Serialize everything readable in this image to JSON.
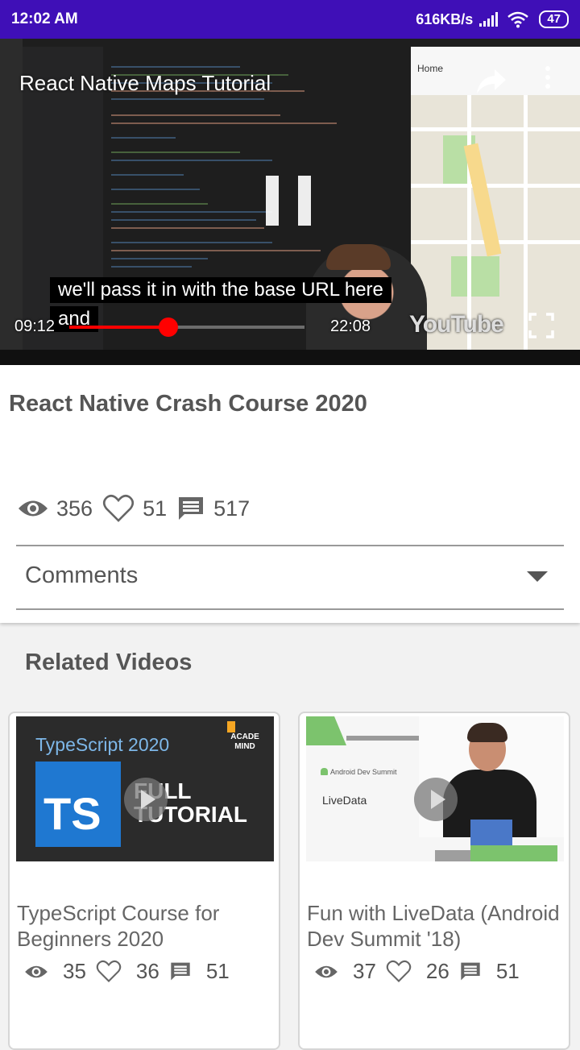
{
  "status_bar": {
    "time": "12:02 AM",
    "network_speed": "616KB/s",
    "battery": "47"
  },
  "player": {
    "video_title": "React Native Maps Tutorial",
    "caption_line1": "we'll pass it in with the base URL here",
    "caption_line2": "and",
    "current_time": "09:12",
    "total_time": "22:08",
    "progress": 0.42,
    "logo_text": "YouTube",
    "map_home_label": "Home"
  },
  "details": {
    "title": "React Native Crash Course 2020",
    "views": "356",
    "likes": "51",
    "comments": "517",
    "comments_label": "Comments"
  },
  "related": {
    "heading": "Related Videos",
    "videos": [
      {
        "title": "TypeScript Course for Beginners 2020",
        "views": "35",
        "likes": "36",
        "comments": "51",
        "thumb_heading": "TypeScript 2020",
        "thumb_ts": "TS",
        "thumb_full": "FULL",
        "thumb_tutorial": "TUTORIAL",
        "thumb_brand": "ACADE MIND"
      },
      {
        "title": "Fun with LiveData (Android Dev Summit '18)",
        "views": "37",
        "likes": "26",
        "comments": "51",
        "thumb_summit": "Android Dev Summit",
        "thumb_label": "LiveData"
      }
    ]
  },
  "colors": {
    "status_bar": "#3f0fb7",
    "progress": "#ff0000",
    "text_muted": "#555555"
  }
}
